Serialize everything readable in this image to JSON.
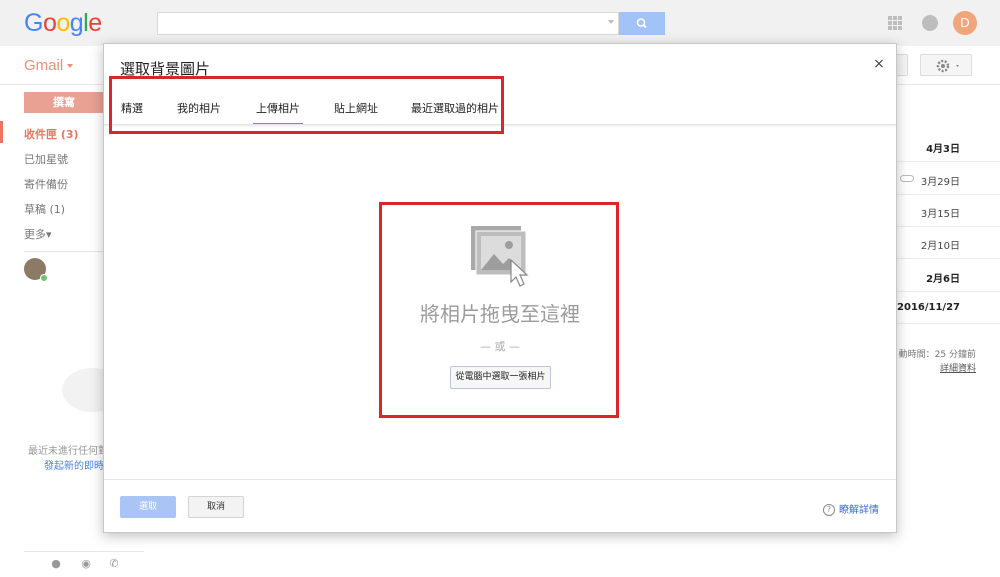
{
  "header": {
    "logo_letters": [
      {
        "ch": "G",
        "color": "#4285f4"
      },
      {
        "ch": "o",
        "color": "#ea4335"
      },
      {
        "ch": "o",
        "color": "#fbbc05"
      },
      {
        "ch": "g",
        "color": "#4285f4"
      },
      {
        "ch": "l",
        "color": "#34a853"
      },
      {
        "ch": "e",
        "color": "#ea4335"
      }
    ],
    "app_label": "Gmail",
    "account_initial": "D"
  },
  "sidebar": {
    "compose": "撰寫",
    "items": [
      {
        "label": "收件匣 (3)"
      },
      {
        "label": "已加星號"
      },
      {
        "label": "寄件備份"
      },
      {
        "label": "草稿 (1)"
      },
      {
        "label": "更多▾"
      }
    ],
    "chat_empty_line1": "最近未進行任何對",
    "chat_empty_line2": "發起新的即時"
  },
  "mail_list": {
    "dates": [
      "4月3日",
      "3月29日",
      "3月15日",
      "2月10日",
      "2月6日",
      "2016/11/27"
    ],
    "activity_line": "動時間：25 分鐘前",
    "details_link": "詳細資料"
  },
  "dialog": {
    "title": "選取背景圖片",
    "close_label": "×",
    "tabs": [
      "精選",
      "我的相片",
      "上傳相片",
      "貼上網址",
      "最近選取過的相片"
    ],
    "active_tab": "上傳相片",
    "drop_hint": "將相片拖曳至這裡",
    "or_text": "— 或 —",
    "choose_file_button": "從電腦中選取一張相片",
    "select_button": "選取",
    "cancel_button": "取消",
    "learn_more": "瞭解詳情",
    "help_glyph": "?"
  },
  "colors": {
    "accent": "#4d90fe",
    "highlight_box": "#d9262b",
    "gmail_red": "#f08c73"
  }
}
